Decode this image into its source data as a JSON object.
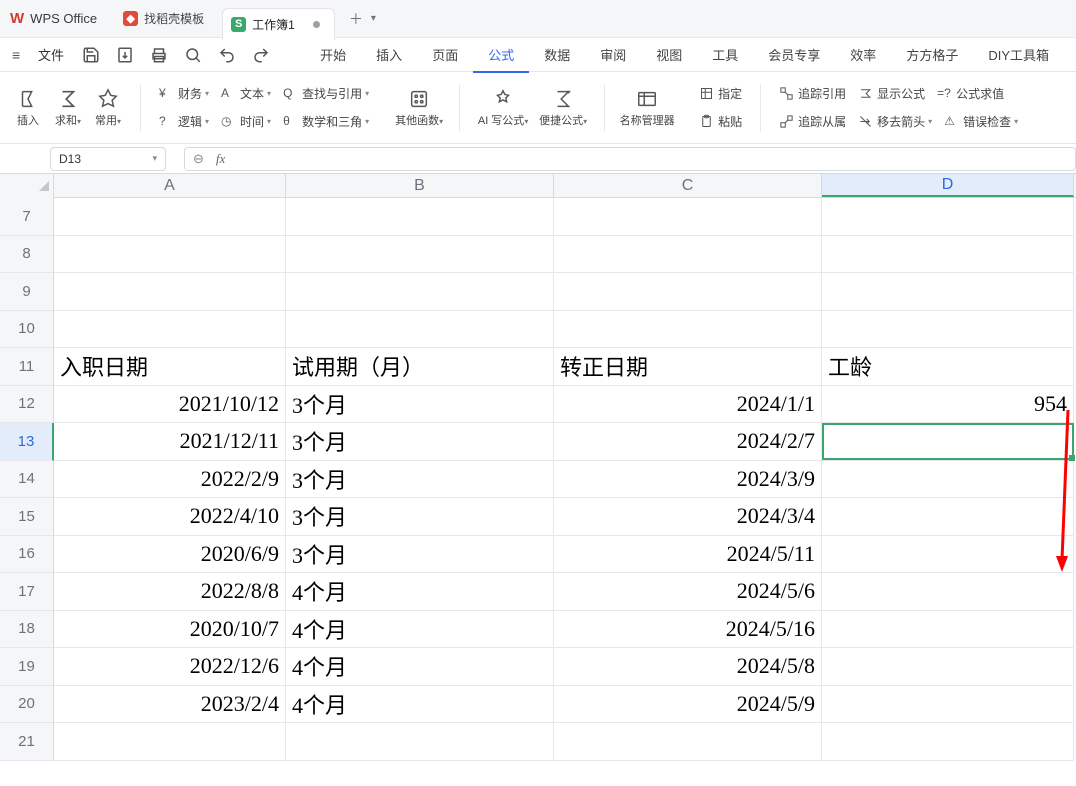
{
  "app_name": "WPS Office",
  "tabs": {
    "template": "找稻壳模板",
    "workbook": "工作簿1"
  },
  "menu": {
    "file": "文件",
    "start": "开始",
    "insert": "插入",
    "page": "页面",
    "formula": "公式",
    "data": "数据",
    "review": "审阅",
    "view": "视图",
    "tools": "工具",
    "vip": "会员专享",
    "efficiency": "效率",
    "ffgz": "方方格子",
    "diy": "DIY工具箱"
  },
  "ribbon": {
    "insert_fn": "插入",
    "sum": "求和",
    "common": "常用",
    "finance": "财务",
    "text": "文本",
    "lookup": "查找与引用",
    "logic": "逻辑",
    "time": "时间",
    "math": "数学和三角",
    "other": "其他函数",
    "ai_write": "AI 写公式",
    "quick": "便捷公式",
    "name_mgr": "名称管理器",
    "named": "指定",
    "paste": "粘贴",
    "trace_ref": "追踪引用",
    "trace_dep": "追踪从属",
    "show_formula": "显示公式",
    "remove_arrows": "移去箭头",
    "eval": "公式求值",
    "error_check": "错误检查"
  },
  "namebox": "D13",
  "columns": [
    "A",
    "B",
    "C",
    "D"
  ],
  "rows": [
    "7",
    "8",
    "9",
    "10",
    "11",
    "12",
    "13",
    "14",
    "15",
    "16",
    "17",
    "18",
    "19",
    "20",
    "21"
  ],
  "headers": {
    "a": "入职日期",
    "b": "试用期（月）",
    "c": "转正日期",
    "d": "工龄"
  },
  "data": [
    {
      "a": "2021/10/12",
      "b": "3个月",
      "c": "2024/1/1",
      "d": "954"
    },
    {
      "a": "2021/12/11",
      "b": "3个月",
      "c": "2024/2/7",
      "d": ""
    },
    {
      "a": "2022/2/9",
      "b": "3个月",
      "c": "2024/3/9",
      "d": ""
    },
    {
      "a": "2022/4/10",
      "b": "3个月",
      "c": "2024/3/4",
      "d": ""
    },
    {
      "a": "2020/6/9",
      "b": "3个月",
      "c": "2024/5/11",
      "d": ""
    },
    {
      "a": "2022/8/8",
      "b": "4个月",
      "c": "2024/5/6",
      "d": ""
    },
    {
      "a": "2020/10/7",
      "b": "4个月",
      "c": "2024/5/16",
      "d": ""
    },
    {
      "a": "2022/12/6",
      "b": "4个月",
      "c": "2024/5/8",
      "d": ""
    },
    {
      "a": "2023/2/4",
      "b": "4个月",
      "c": "2024/5/9",
      "d": ""
    }
  ]
}
